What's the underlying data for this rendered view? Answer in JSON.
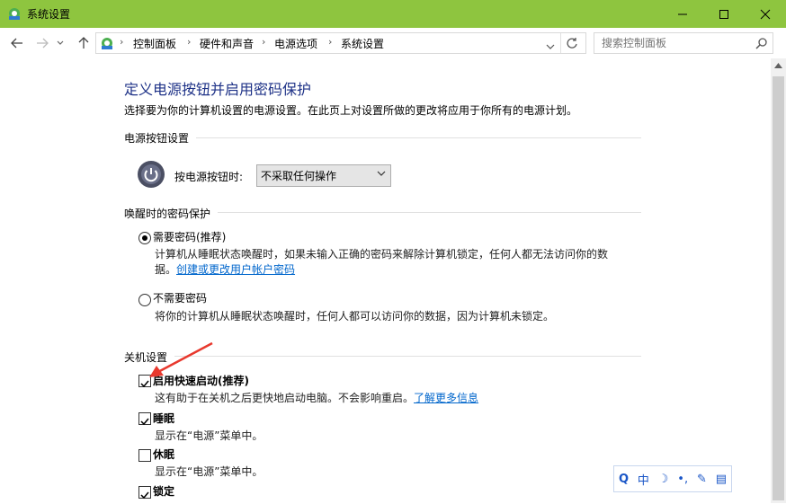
{
  "window": {
    "title": "系统设置"
  },
  "address_bar": {
    "crumbs": [
      "控制面板",
      "硬件和声音",
      "电源选项",
      "系统设置"
    ]
  },
  "search": {
    "placeholder": "搜索控制面板"
  },
  "page": {
    "heading": "定义电源按钮并启用密码保护",
    "description": "选择要为你的计算机设置的电源设置。在此页上对设置所做的更改将应用于你所有的电源计划。"
  },
  "power_button": {
    "section_title": "电源按钮设置",
    "label": "按电源按钮时:",
    "selected": "不采取任何操作"
  },
  "wake_password": {
    "section_title": "唤醒时的密码保护",
    "options": [
      {
        "label": "需要密码(推荐)",
        "selected": true,
        "desc_line1": "计算机从睡眠状态唤醒时，如果未输入正确的密码来解除计算机锁定，任何人都无法访问你的数",
        "desc_line2_prefix": "据。",
        "link": "创建或更改用户帐户密码"
      },
      {
        "label": "不需要密码",
        "selected": false,
        "desc_line1": "将你的计算机从睡眠状态唤醒时，任何人都可以访问你的数据，因为计算机未锁定。"
      }
    ]
  },
  "shutdown": {
    "section_title": "关机设置",
    "items": [
      {
        "label": "启用快速启动(推荐)",
        "checked": true,
        "desc": "这有助于在关机之后更快地启动电脑。不会影响重启。",
        "link": "了解更多信息"
      },
      {
        "label": "睡眠",
        "checked": true,
        "desc": "显示在“电源”菜单中。"
      },
      {
        "label": "休眠",
        "checked": false,
        "desc": "显示在“电源”菜单中。"
      },
      {
        "label": "锁定",
        "checked": true,
        "desc": ""
      }
    ]
  },
  "ime_toolbar": {
    "items": [
      "Q",
      "中",
      "☽",
      "•,",
      "✎",
      "▤"
    ]
  },
  "colors": {
    "titlebar": "#8ec53f",
    "heading": "#1e3287",
    "link": "#0066cc",
    "annotation_arrow": "#e8392e"
  }
}
